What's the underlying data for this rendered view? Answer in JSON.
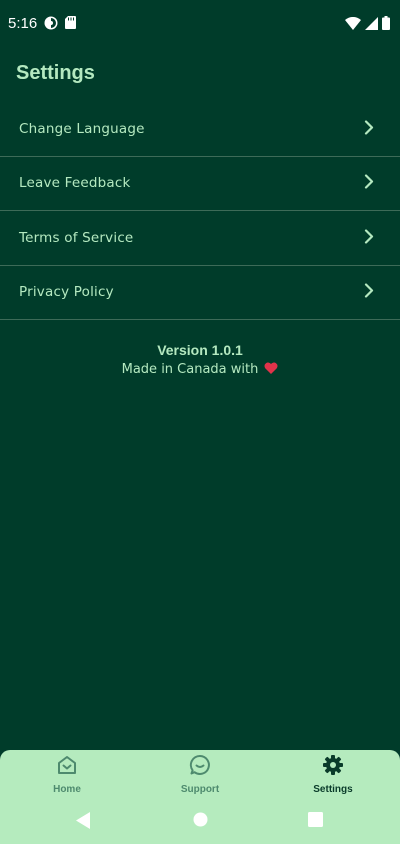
{
  "status_bar": {
    "time": "5:16",
    "left_icons": [
      "sync-status-icon",
      "sd-card-icon"
    ],
    "right_icons": [
      "wifi-icon",
      "cell-signal-icon",
      "battery-icon"
    ]
  },
  "page": {
    "title": "Settings"
  },
  "settings": {
    "items": [
      {
        "label": "Change Language"
      },
      {
        "label": "Leave Feedback"
      },
      {
        "label": "Terms of Service"
      },
      {
        "label": "Privacy Policy"
      }
    ]
  },
  "footer": {
    "version": "Version 1.0.1",
    "made_in": "Made in Canada with"
  },
  "bottom_nav": {
    "items": [
      {
        "label": "Home",
        "icon": "home-icon"
      },
      {
        "label": "Support",
        "icon": "chat-icon"
      },
      {
        "label": "Settings",
        "icon": "gear-icon",
        "active": true
      }
    ]
  },
  "colors": {
    "background": "#003c2a",
    "accent_text": "#b4e9c0",
    "divider": "#3d6b58",
    "nav_background": "#b5ebbe",
    "nav_inactive": "#4e8a6e",
    "nav_active": "#0a3b2a",
    "heart": "#e0334a"
  }
}
